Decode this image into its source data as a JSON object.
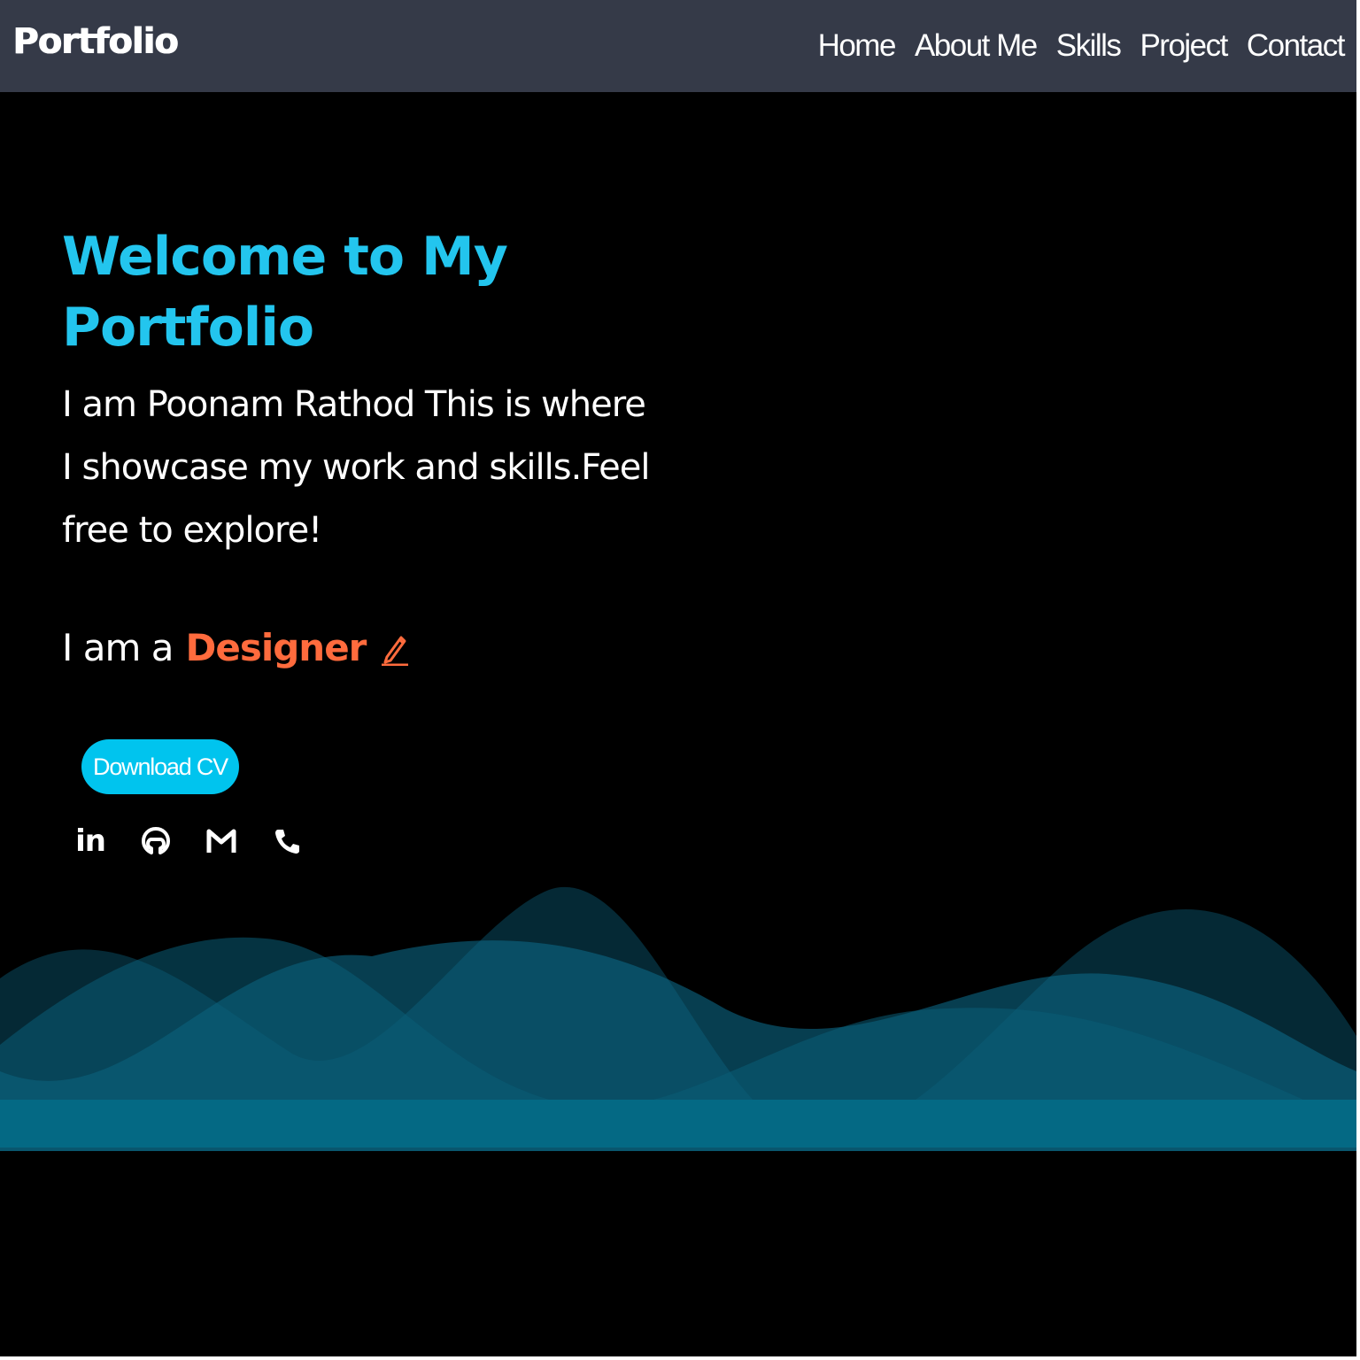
{
  "navbar": {
    "brand": "Portfolio",
    "links": [
      "Home",
      "About Me",
      "Skills",
      "Project",
      "Contact"
    ]
  },
  "hero": {
    "title": "Welcome to My Portfolio",
    "intro": "I am Poonam Rathod This is where I showcase my work and skills.Feel free to explore!",
    "role_prefix": "I am a",
    "role": "Designer",
    "download_label": "Download CV"
  },
  "socials": [
    "linkedin-icon",
    "github-icon",
    "gmail-icon",
    "phone-icon"
  ],
  "colors": {
    "navbar_bg": "#353a48",
    "accent_cyan": "#23c5ee",
    "accent_orange": "#ff6b3d",
    "button_bg": "#00c4ee",
    "background": "#000000"
  }
}
